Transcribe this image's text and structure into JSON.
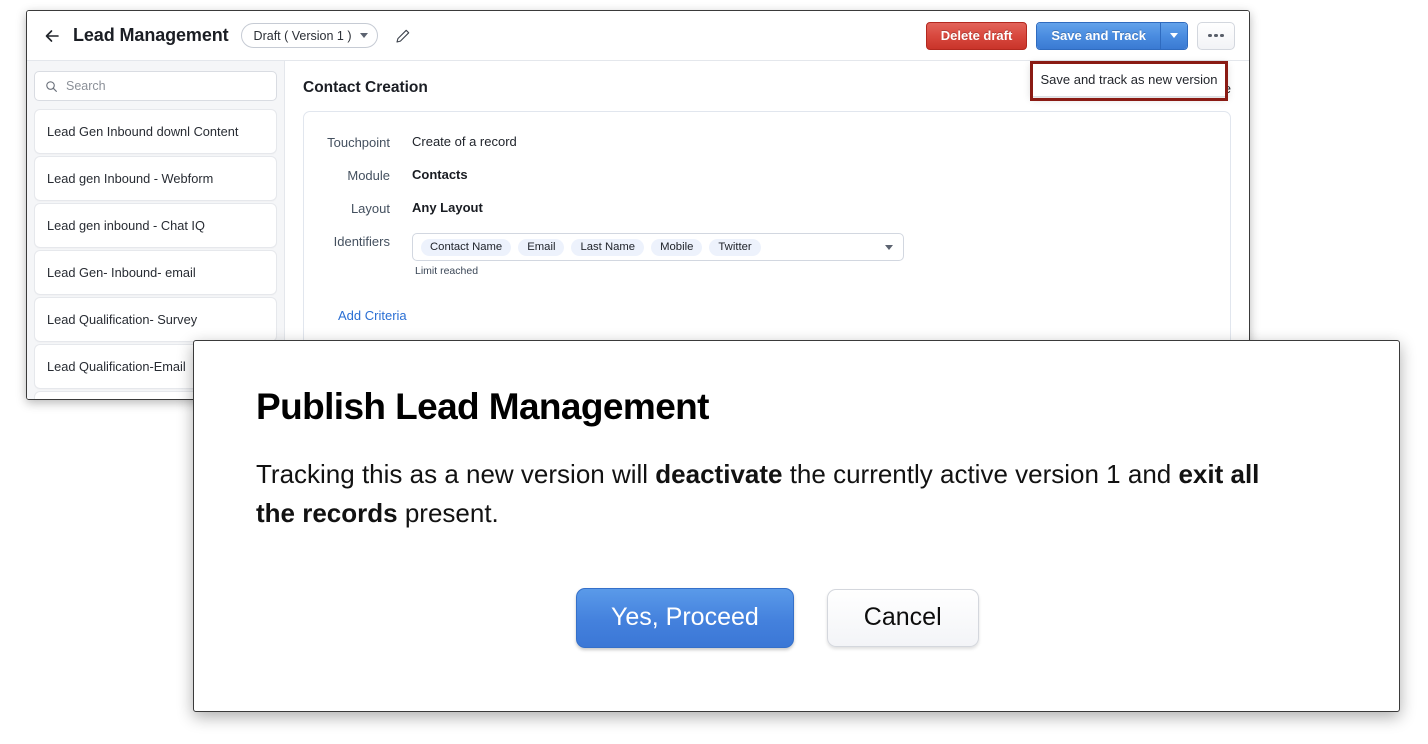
{
  "app": {
    "title": "Lead Management",
    "version_chip": "Draft ( Version 1 )",
    "back_icon": "back-arrow-icon",
    "edit_icon": "pencil-icon"
  },
  "toolbar": {
    "delete_draft_label": "Delete draft",
    "save_and_track_label": "Save and Track",
    "more_label": "more-options",
    "dropdown": {
      "items": [
        {
          "label": "Save and track as new version"
        }
      ]
    },
    "colors": {
      "danger": "#c9342a",
      "primary": "#3a7ad3",
      "annotation": "#8a1b14"
    }
  },
  "sidebar": {
    "search": {
      "placeholder": "Search",
      "value": "",
      "icon": "search-icon"
    },
    "items": [
      {
        "label": "Lead Gen Inbound downl Content"
      },
      {
        "label": "Lead gen Inbound - Webform"
      },
      {
        "label": "Lead gen inbound - Chat IQ"
      },
      {
        "label": "Lead Gen- Inbound- email"
      },
      {
        "label": "Lead Qualification- Survey"
      },
      {
        "label": "Lead Qualification-Email"
      },
      {
        "label": ""
      }
    ]
  },
  "main": {
    "section_title": "Contact Creation",
    "end_state": {
      "label": "Mark as end state",
      "checked": true
    },
    "fields": [
      {
        "label": "Touchpoint",
        "value": "Create of a record",
        "weight": "regular"
      },
      {
        "label": "Module",
        "value": "Contacts",
        "weight": "bold"
      },
      {
        "label": "Layout",
        "value": "Any Layout",
        "weight": "bold"
      }
    ],
    "identifiers": {
      "label": "Identifiers",
      "chips": [
        "Contact Name",
        "Email",
        "Last Name",
        "Mobile",
        "Twitter"
      ],
      "helper_text": "Limit reached"
    },
    "add_criteria_label": "Add Criteria"
  },
  "modal": {
    "title": "Publish Lead Management",
    "body": {
      "part1": "Tracking this as a new version will ",
      "bold1": "deactivate",
      "part2": " the currently active version 1 and ",
      "bold2": "exit all the records",
      "part3": " present."
    },
    "confirm_label": "Yes, Proceed",
    "cancel_label": "Cancel"
  }
}
